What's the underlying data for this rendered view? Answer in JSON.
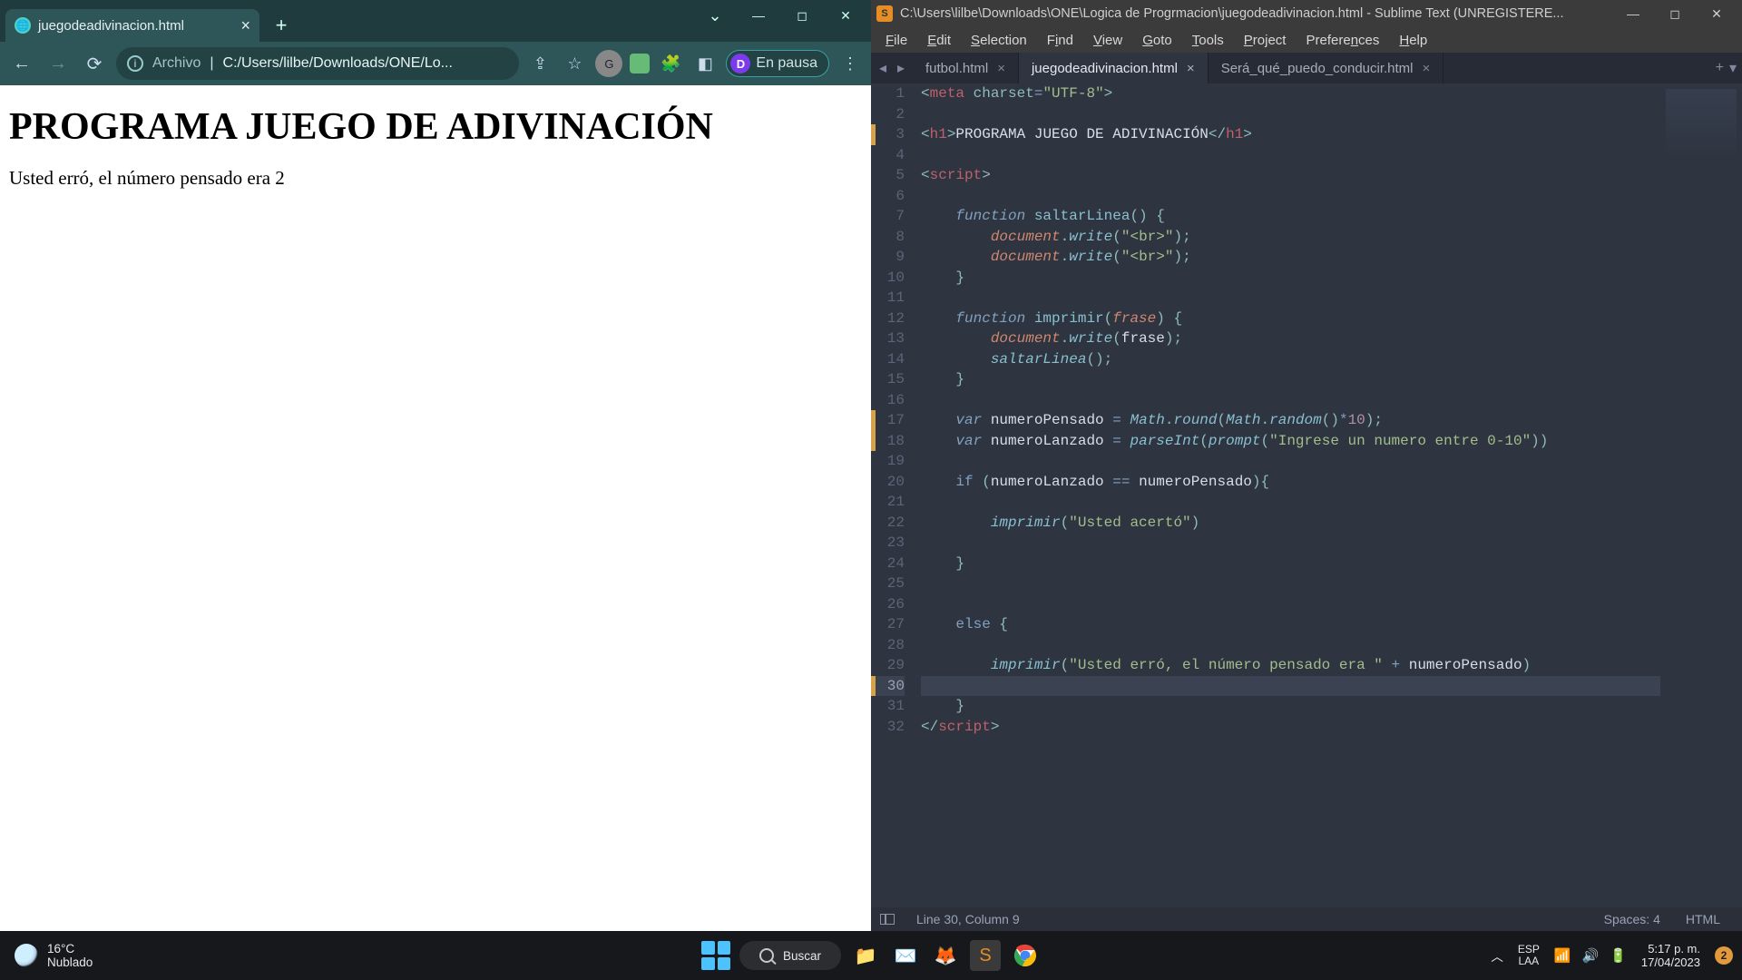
{
  "chrome": {
    "tab_title": "juegodeadivinacion.html",
    "omnibox_prefix": "Archivo",
    "omnibox_path": "C:/Users/lilbe/Downloads/ONE/Lo...",
    "profile_letter": "D",
    "profile_status": "En pausa",
    "page": {
      "heading": "PROGRAMA JUEGO DE ADIVINACIÓN",
      "body": "Usted erró, el número pensado era 2"
    }
  },
  "sublime": {
    "title": "C:\\Users\\lilbe\\Downloads\\ONE\\Logica de Progrmacion\\juegodeadivinacion.html - Sublime Text (UNREGISTERE...",
    "menus": [
      "File",
      "Edit",
      "Selection",
      "Find",
      "View",
      "Goto",
      "Tools",
      "Project",
      "Preferences",
      "Help"
    ],
    "tabs": [
      {
        "label": "futbol.html",
        "active": false
      },
      {
        "label": "juegodeadivinacion.html",
        "active": true
      },
      {
        "label": "Será_qué_puedo_conducir.html",
        "active": false
      }
    ],
    "modified_lines": [
      3,
      17,
      18,
      30
    ],
    "current_line": 30,
    "status": {
      "pos": "Line 30, Column 9",
      "spaces": "Spaces: 4",
      "lang": "HTML"
    }
  },
  "taskbar": {
    "weather_temp": "16°C",
    "weather_cond": "Nublado",
    "search_placeholder": "Buscar",
    "lang1": "ESP",
    "lang2": "LAA",
    "time": "5:17 p. m.",
    "date": "17/04/2023",
    "notif_count": "2"
  }
}
